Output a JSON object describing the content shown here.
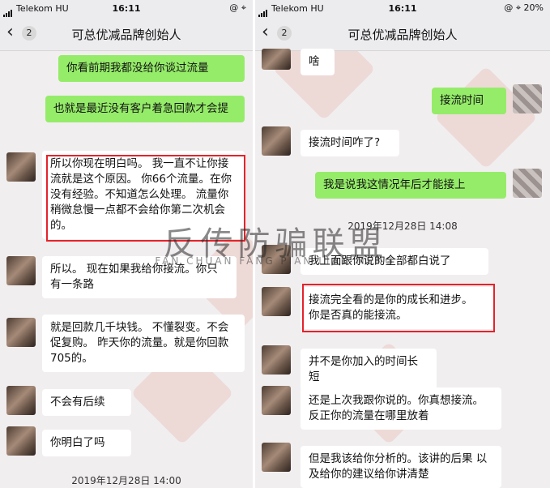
{
  "status_bar_left": {
    "carrier": "Telekom HU",
    "time": "16:11",
    "right": "@ ⌖"
  },
  "status_bar_right": {
    "carrier": "Telekom HU",
    "time": "16:11",
    "right": "@ ⌖ 20%"
  },
  "nav": {
    "back_count": "2",
    "title": "可总优减品牌创始人"
  },
  "left_chat": {
    "msg1": "你看前期我都没给你谈过流量",
    "msg2": "也就是最近没有客户着急回款才会提",
    "msg3": "所以你现在明白吗。 我一直不让你接流就是这个原因。 你66个流量。在你没有经验。不知道怎么处理。 流量你稍微怠慢一点都不会给你第二次机会的。",
    "msg4": "所以。 现在如果我给你接流。你只有一条路",
    "msg5": "就是回款几千块钱。 不懂裂变。不会促复购。 昨天你的流量。就是你回款705的。",
    "msg6": "不会有后续",
    "msg7": "你明白了吗",
    "timestamp": "2019年12月28日 14:00"
  },
  "right_chat": {
    "msg1": "啥",
    "msg2": "接流时间",
    "msg3": "接流时间咋了?",
    "msg4": "我是说我这情况年后才能接上",
    "timestamp": "2019年12月28日 14:08",
    "msg5": "我上面跟你说的全部都白说了",
    "msg6": "接流完全看的是你的成长和进步。 你是否真的能接流。",
    "msg7": "并不是你加入的时间长短",
    "msg8": "还是上次我跟你说的。你真想接流。反正你的流量在哪里放着",
    "msg9": "但是我该给你分析的。该讲的后果 以及给你的建议给你讲清楚"
  },
  "watermark": {
    "main": "反传防骗联盟",
    "sub": "FAN CHUAN FANG PIAN LIAN MENG"
  },
  "colors": {
    "outgoing": "#95ec69",
    "incoming": "#ffffff",
    "highlight": "#e4232a"
  }
}
